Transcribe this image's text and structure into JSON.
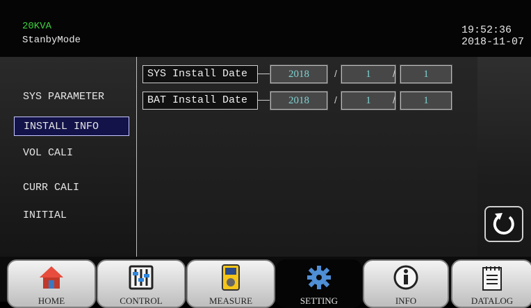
{
  "header": {
    "model": "20KVA",
    "mode": "StanbyMode",
    "time": "19:52:36",
    "date": "2018-11-07"
  },
  "sidebar": {
    "items": [
      {
        "label": "SYS PARAMETER",
        "active": false
      },
      {
        "label": "INSTALL INFO",
        "active": true
      },
      {
        "label": "VOL CALI",
        "active": false
      },
      {
        "label": "CURR CALI",
        "active": false
      },
      {
        "label": "INITIAL",
        "active": false
      }
    ]
  },
  "install": {
    "rows": [
      {
        "label": "SYS Install Date",
        "year": "2018",
        "month": "1",
        "day": "1"
      },
      {
        "label": "BAT Install Date",
        "year": "2018",
        "month": "1",
        "day": "1"
      }
    ],
    "separator": "/"
  },
  "nav": {
    "tabs": [
      {
        "label": "HOME",
        "icon": "home-icon"
      },
      {
        "label": "CONTROL",
        "icon": "control-icon"
      },
      {
        "label": "MEASURE",
        "icon": "measure-icon"
      },
      {
        "label": "SETTING",
        "icon": "gear-icon",
        "active": true
      },
      {
        "label": "INFO",
        "icon": "info-icon"
      },
      {
        "label": "DATALOG",
        "icon": "datalog-icon"
      }
    ]
  },
  "colors": {
    "model_text": "#3fd13f",
    "active_item_bg": "#13134a",
    "field_text": "#7fd3d3"
  }
}
